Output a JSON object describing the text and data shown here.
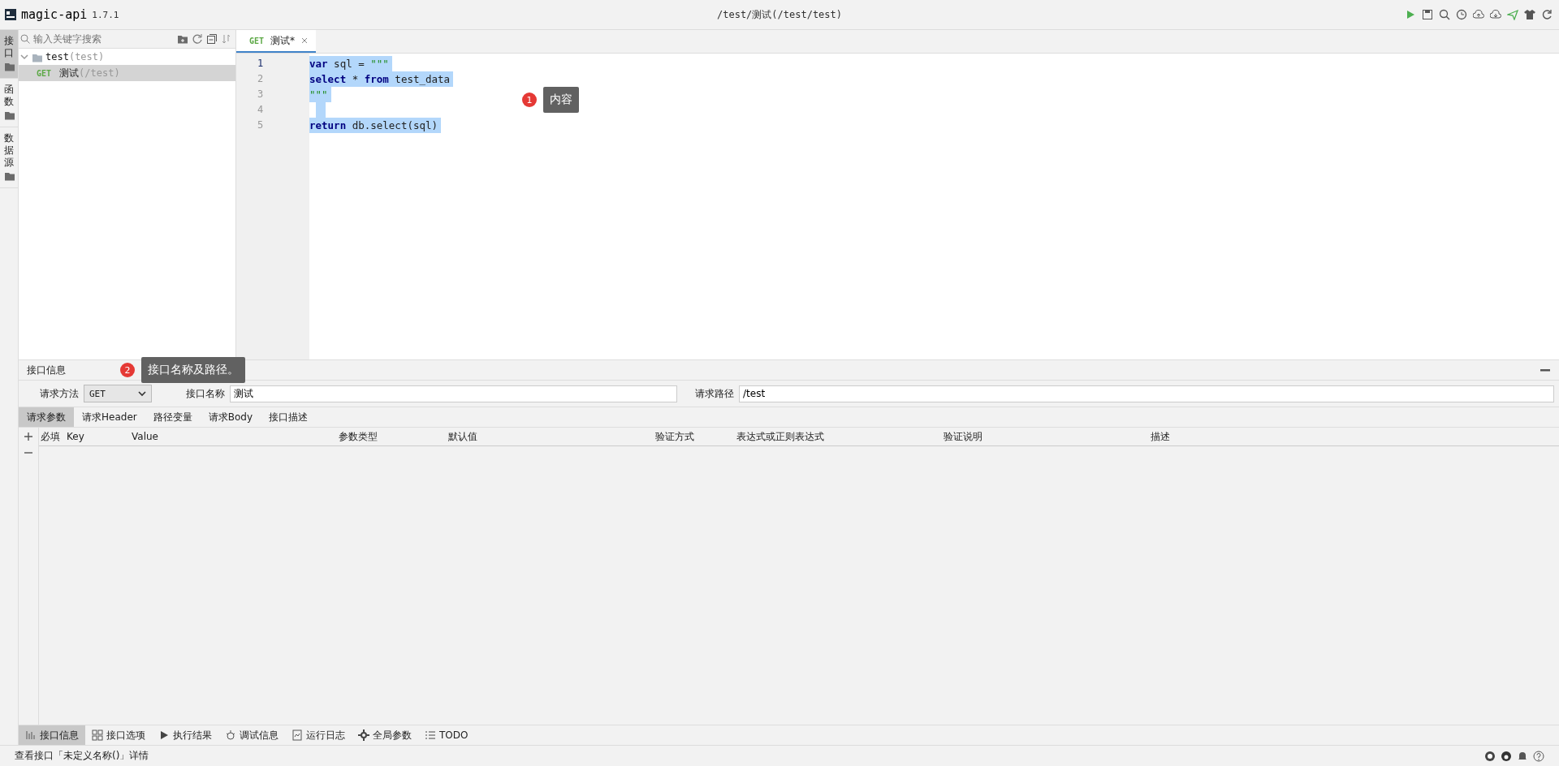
{
  "header": {
    "app_name": "magic-api",
    "version": "1.7.1",
    "path": "/test/测试(/test/test)"
  },
  "rail": [
    {
      "label": "接口",
      "selected": true
    },
    {
      "label": "函数",
      "selected": false
    },
    {
      "label": "数据源",
      "selected": false
    }
  ],
  "tree": {
    "search": {
      "placeholder": "输入关键字搜索"
    },
    "items": [
      {
        "name": "test",
        "path": "(test)",
        "expanded": true,
        "selected": false,
        "children": [
          {
            "method": "GET",
            "name": "测试",
            "path": "(/test)",
            "selected": true
          }
        ]
      }
    ]
  },
  "editor": {
    "tabs": [
      {
        "method": "GET",
        "label": "测试*",
        "selected": true
      }
    ],
    "lines": [
      {
        "number": "1",
        "tokens": [
          {
            "kind": "keyword",
            "text": "var"
          },
          {
            "kind": "plain",
            "text": " sql = "
          },
          {
            "kind": "string",
            "text": "\"\"\""
          }
        ]
      },
      {
        "number": "2",
        "tokens": [
          {
            "kind": "keyword",
            "text": "select"
          },
          {
            "kind": "plain",
            "text": " * "
          },
          {
            "kind": "keyword",
            "text": "from"
          },
          {
            "kind": "plain",
            "text": " test_data"
          }
        ]
      },
      {
        "number": "3",
        "tokens": [
          {
            "kind": "string",
            "text": "\"\"\""
          }
        ]
      },
      {
        "number": "4"
      },
      {
        "number": "5",
        "tokens": [
          {
            "kind": "keyword",
            "text": "return"
          },
          {
            "kind": "plain",
            "text": " db.select(sql)"
          }
        ]
      }
    ]
  },
  "annotations": [
    {
      "number": "1",
      "text": "内容"
    },
    {
      "number": "2",
      "text": "接口名称及路径。"
    }
  ],
  "info": {
    "title": "接口信息",
    "fields": [
      {
        "kind": "select",
        "label": "请求方法",
        "value": "GET"
      },
      {
        "kind": "text",
        "label": "接口名称",
        "value": "测试"
      },
      {
        "kind": "text",
        "label": "请求路径",
        "value": "/test"
      }
    ],
    "tabs": [
      {
        "label": "请求参数",
        "selected": true
      },
      {
        "label": "请求Header",
        "selected": false
      },
      {
        "label": "路径变量",
        "selected": false
      },
      {
        "label": "请求Body",
        "selected": false
      },
      {
        "label": "接口描述",
        "selected": false
      }
    ],
    "columns": [
      "必填",
      "Key",
      "Value",
      "参数类型",
      "默认值",
      "验证方式",
      "表达式或正则表达式",
      "验证说明",
      "描述"
    ]
  },
  "bottom_tabs": [
    {
      "label": "接口信息",
      "selected": true
    },
    {
      "label": "接口选项",
      "selected": false
    },
    {
      "label": "执行结果",
      "selected": false
    },
    {
      "label": "调试信息",
      "selected": false
    },
    {
      "label": "运行日志",
      "selected": false
    },
    {
      "label": "全局参数",
      "selected": false
    },
    {
      "label": "TODO",
      "selected": false
    }
  ],
  "status_bar": {
    "text": "查看接口「未定义名称()」详情"
  }
}
